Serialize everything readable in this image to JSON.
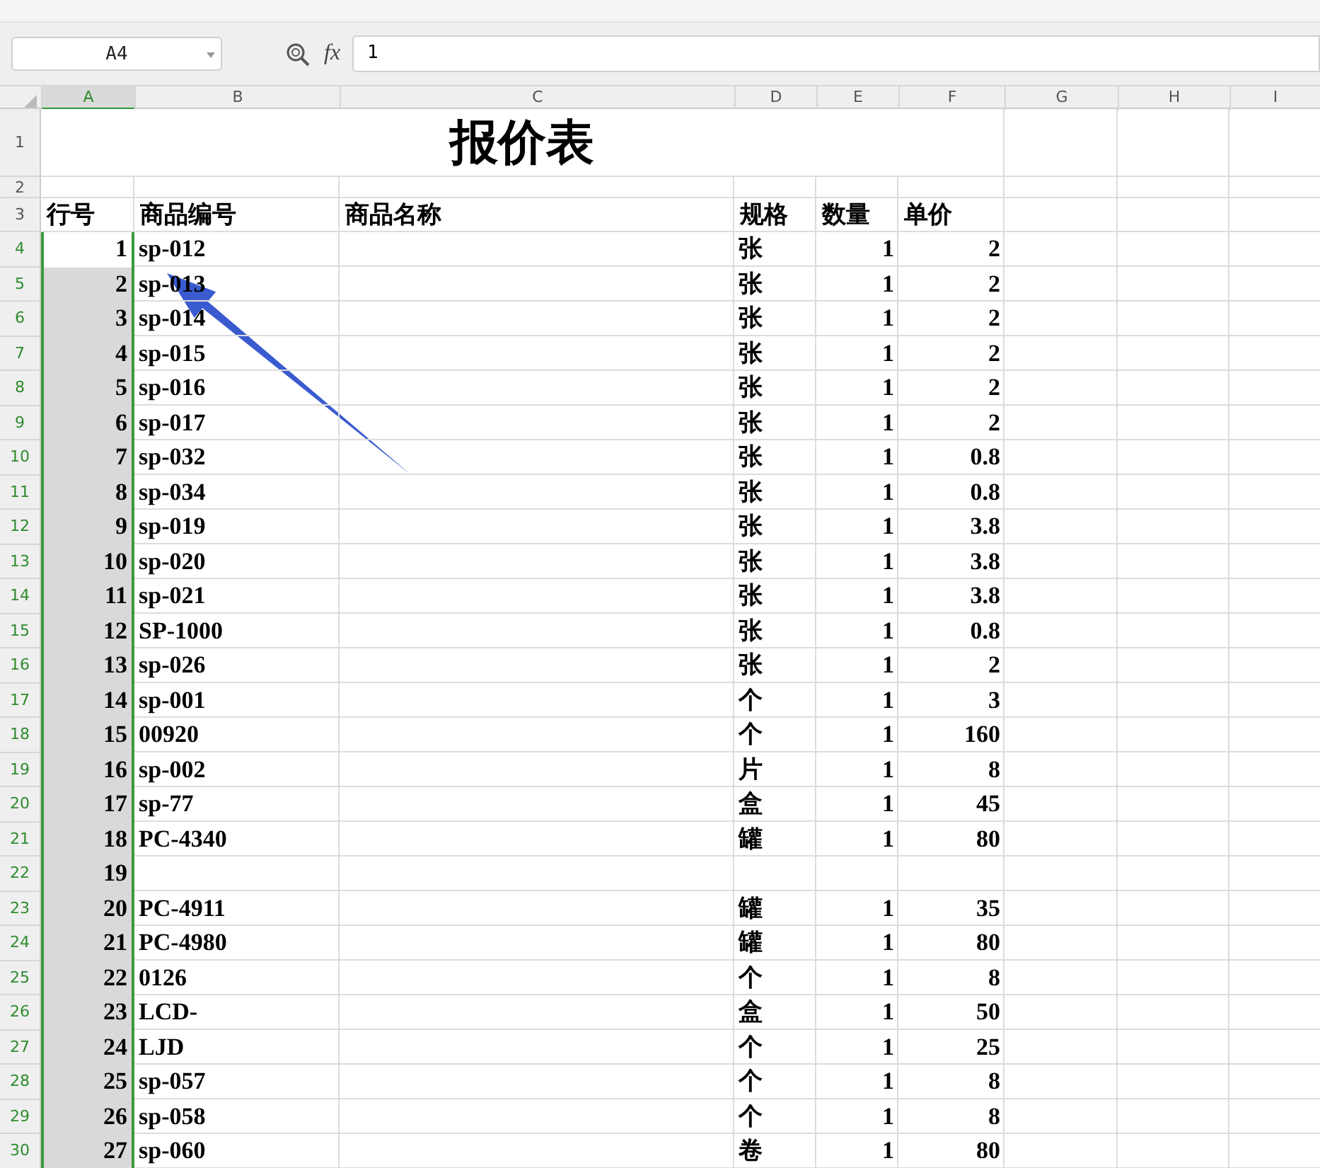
{
  "formula_bar": {
    "name_box": "A4",
    "fx_label": "fx",
    "formula": "1"
  },
  "columns": [
    {
      "label": "A",
      "selected": true
    },
    {
      "label": "B",
      "selected": false
    },
    {
      "label": "C",
      "selected": false
    },
    {
      "label": "D",
      "selected": false
    },
    {
      "label": "E",
      "selected": false
    },
    {
      "label": "F",
      "selected": false
    },
    {
      "label": "G",
      "selected": false
    },
    {
      "label": "H",
      "selected": false
    },
    {
      "label": "I",
      "selected": false
    }
  ],
  "title": {
    "row": "1",
    "text": "报价表"
  },
  "blank_row": "2",
  "header": {
    "row": "3",
    "cells": [
      "行号",
      "商品编号",
      "商品名称",
      "规格",
      "数量",
      "单价"
    ]
  },
  "rows": [
    {
      "row": "4",
      "selected": true,
      "active": true,
      "cells": [
        "1",
        "sp-012",
        "",
        "张",
        "1",
        "2"
      ]
    },
    {
      "row": "5",
      "selected": true,
      "active": false,
      "cells": [
        "2",
        "sp-013",
        "",
        "张",
        "1",
        "2"
      ]
    },
    {
      "row": "6",
      "selected": true,
      "active": false,
      "cells": [
        "3",
        "sp-014",
        "",
        "张",
        "1",
        "2"
      ]
    },
    {
      "row": "7",
      "selected": true,
      "active": false,
      "cells": [
        "4",
        "sp-015",
        "",
        "张",
        "1",
        "2"
      ]
    },
    {
      "row": "8",
      "selected": true,
      "active": false,
      "cells": [
        "5",
        "sp-016",
        "",
        "张",
        "1",
        "2"
      ]
    },
    {
      "row": "9",
      "selected": true,
      "active": false,
      "cells": [
        "6",
        "sp-017",
        "",
        "张",
        "1",
        "2"
      ]
    },
    {
      "row": "10",
      "selected": true,
      "active": false,
      "cells": [
        "7",
        "sp-032",
        "",
        "张",
        "1",
        "0.8"
      ]
    },
    {
      "row": "11",
      "selected": true,
      "active": false,
      "cells": [
        "8",
        "sp-034",
        "",
        "张",
        "1",
        "0.8"
      ]
    },
    {
      "row": "12",
      "selected": true,
      "active": false,
      "cells": [
        "9",
        "sp-019",
        "",
        "张",
        "1",
        "3.8"
      ]
    },
    {
      "row": "13",
      "selected": true,
      "active": false,
      "cells": [
        "10",
        "sp-020",
        "",
        "张",
        "1",
        "3.8"
      ]
    },
    {
      "row": "14",
      "selected": true,
      "active": false,
      "cells": [
        "11",
        "sp-021",
        "",
        "张",
        "1",
        "3.8"
      ]
    },
    {
      "row": "15",
      "selected": true,
      "active": false,
      "cells": [
        "12",
        "SP-1000",
        "",
        "张",
        "1",
        "0.8"
      ]
    },
    {
      "row": "16",
      "selected": true,
      "active": false,
      "cells": [
        "13",
        "sp-026",
        "",
        "张",
        "1",
        "2"
      ]
    },
    {
      "row": "17",
      "selected": true,
      "active": false,
      "cells": [
        "14",
        "sp-001",
        "",
        "个",
        "1",
        "3"
      ]
    },
    {
      "row": "18",
      "selected": true,
      "active": false,
      "cells": [
        "15",
        "00920",
        "",
        "个",
        "1",
        "160"
      ]
    },
    {
      "row": "19",
      "selected": true,
      "active": false,
      "cells": [
        "16",
        "sp-002",
        "",
        "片",
        "1",
        "8"
      ]
    },
    {
      "row": "20",
      "selected": true,
      "active": false,
      "cells": [
        "17",
        "sp-77",
        "",
        "盒",
        "1",
        "45"
      ]
    },
    {
      "row": "21",
      "selected": true,
      "active": false,
      "cells": [
        "18",
        "PC-4340",
        "",
        "罐",
        "1",
        "80"
      ]
    },
    {
      "row": "22",
      "selected": true,
      "active": false,
      "cells": [
        "19",
        "",
        "",
        "",
        "",
        ""
      ]
    },
    {
      "row": "23",
      "selected": true,
      "active": false,
      "cells": [
        "20",
        "PC-4911",
        "",
        "罐",
        "1",
        "35"
      ]
    },
    {
      "row": "24",
      "selected": true,
      "active": false,
      "cells": [
        "21",
        "PC-4980",
        "",
        "罐",
        "1",
        "80"
      ]
    },
    {
      "row": "25",
      "selected": true,
      "active": false,
      "cells": [
        "22",
        "0126",
        "",
        "个",
        "1",
        "8"
      ]
    },
    {
      "row": "26",
      "selected": true,
      "active": false,
      "cells": [
        "23",
        "LCD-",
        "",
        "盒",
        "1",
        "50"
      ]
    },
    {
      "row": "27",
      "selected": true,
      "active": false,
      "cells": [
        "24",
        "LJD",
        "",
        "个",
        "1",
        "25"
      ]
    },
    {
      "row": "28",
      "selected": true,
      "active": false,
      "cells": [
        "25",
        "sp-057",
        "",
        "个",
        "1",
        "8"
      ]
    },
    {
      "row": "29",
      "selected": true,
      "active": false,
      "cells": [
        "26",
        "sp-058",
        "",
        "个",
        "1",
        "8"
      ]
    },
    {
      "row": "30",
      "selected": true,
      "active": false,
      "cells": [
        "27",
        "sp-060",
        "",
        "卷",
        "1",
        "80"
      ]
    }
  ]
}
